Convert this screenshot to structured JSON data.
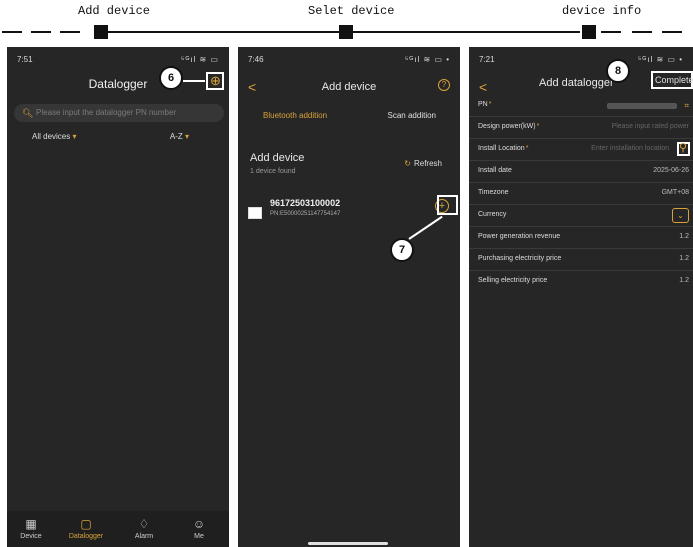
{
  "steps": {
    "step1": "Add device",
    "step2": "Selet device",
    "step3": "device info"
  },
  "callouts": {
    "c6": "6",
    "c7": "7",
    "c8": "8"
  },
  "screen1": {
    "time": "7:51",
    "status_icons": "⁵ᴳıl ≋ ▭",
    "title": "Datalogger",
    "search_placeholder": "Please input the datalogger PN number",
    "filter_left": "All devices",
    "filter_right": "A-Z",
    "tabs": [
      {
        "icon": "▦",
        "label": "Device"
      },
      {
        "icon": "▢",
        "label": "Datalogger"
      },
      {
        "icon": "♢",
        "label": "Alarm"
      },
      {
        "icon": "☺",
        "label": "Me"
      }
    ]
  },
  "screen2": {
    "time": "7:46",
    "status_icons": "⁵ᴳıl ≋ ▭ •",
    "title": "Add device",
    "tab_bluetooth": "Bluetooth addition",
    "tab_scan": "Scan addition",
    "section_title": "Add device",
    "found": "1 device found",
    "refresh": "Refresh",
    "device_id": "96172503100002",
    "device_pn": "PN:E50000251147754147"
  },
  "screen3": {
    "time": "7:21",
    "status_icons": "⁵ᴳıl ≋ ▭ •",
    "title": "Add datalogger",
    "complete": "Complete",
    "fields": {
      "pn": "PN",
      "design_power": "Design power(kW)",
      "design_power_ph": "Please input rated power",
      "location": "Install Location",
      "location_ph": "Enter installation location",
      "date": "Install date",
      "date_val": "2025-06-26",
      "timezone": "Timezone",
      "timezone_val": "GMT+08",
      "currency": "Currency",
      "revenue": "Power generation revenue",
      "revenue_val": "1.2",
      "purchase": "Purchasing electricity price",
      "purchase_val": "1.2",
      "selling": "Selling electricity price",
      "selling_val": "1.2"
    }
  },
  "colors": {
    "accent": "#d9a33a",
    "background": "#262626",
    "highlight": "#ffffff"
  }
}
